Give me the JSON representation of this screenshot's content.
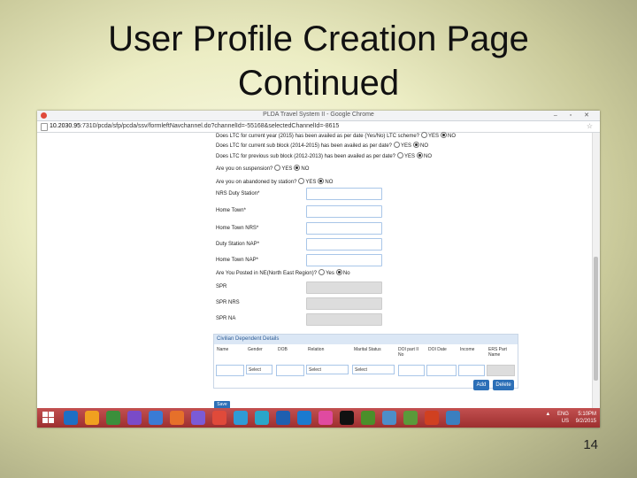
{
  "slide": {
    "title_line1": "User Profile Creation Page",
    "title_line2": "Continued",
    "page_number": "14"
  },
  "browser": {
    "window_title": "PLDA Travel System II - Google Chrome",
    "url_host": "10.2030.95",
    "url_rest": ":7310/pcda/sfp/pcda/ssv/formleftNavchannel.do?channelId=-55168&selectedChannelId=-8615",
    "window_buttons": "– ▫ ✕"
  },
  "form": {
    "questions": [
      {
        "text": "Does LTC for current year (2015) has been availed as per date (Yes/No) LTC scheme?",
        "yes": "YES",
        "no": "NO",
        "selected": "no"
      },
      {
        "text": "Does LTC for current sub block (2014-2015) has been availed as per date?",
        "yes": "YES",
        "no": "NO",
        "selected": "no"
      },
      {
        "text": "Does LTC for previous sub block (2012-2013) has been availed as per date?",
        "yes": "YES",
        "no": "NO",
        "selected": "no"
      },
      {
        "text": "Are you on suspension?",
        "yes": "YES",
        "no": "NO",
        "selected": "no"
      },
      {
        "text": "Are you on abandoned by station?",
        "yes": "YES",
        "no": "NO",
        "selected": "no"
      }
    ],
    "fields": [
      {
        "label": "NRS Duty Station*"
      },
      {
        "label": "Home Town*"
      },
      {
        "label": "Home Town NRS*"
      },
      {
        "label": "Duty Station NAP*"
      },
      {
        "label": "Home Town NAP*"
      }
    ],
    "ne_question": {
      "text": "Are You Posted in NE(North East Region)?",
      "yes": "Yes",
      "no": "No",
      "selected": "no"
    },
    "spr_fields": [
      {
        "label": "SPR"
      },
      {
        "label": "SPR NRS"
      },
      {
        "label": "SPR NA"
      }
    ]
  },
  "civilian": {
    "title": "Civilian Dependent Details",
    "columns": [
      "Name",
      "Gender",
      "DOB",
      "Relation",
      "Marital Status",
      "DOI part II No",
      "DOI Date",
      "Income",
      "ERS Part Name"
    ],
    "gender_select": "Select",
    "relation_select": "Select",
    "marital_select": "Select",
    "add_label": "Add",
    "delete_label": "Delete"
  },
  "save_label": "Save",
  "taskbar": {
    "lang_line1": "ENG",
    "lang_line2": "US",
    "time": "5:10PM",
    "date": "9/2/2015",
    "tray_arrow": "▲",
    "app_colors": [
      "#1d6fc4",
      "#f0a020",
      "#3b8f3b",
      "#7a4bc8",
      "#3a7bd5",
      "#e6702a",
      "#7b5bd6",
      "#e04a3a",
      "#2f9bd6",
      "#2aa6c9",
      "#1f5fb0",
      "#1a7ad0",
      "#e04aa0",
      "#111111",
      "#4a8f2a",
      "#4d8ec9",
      "#5a9a3a",
      "#d04020",
      "#3b7fc0"
    ]
  }
}
